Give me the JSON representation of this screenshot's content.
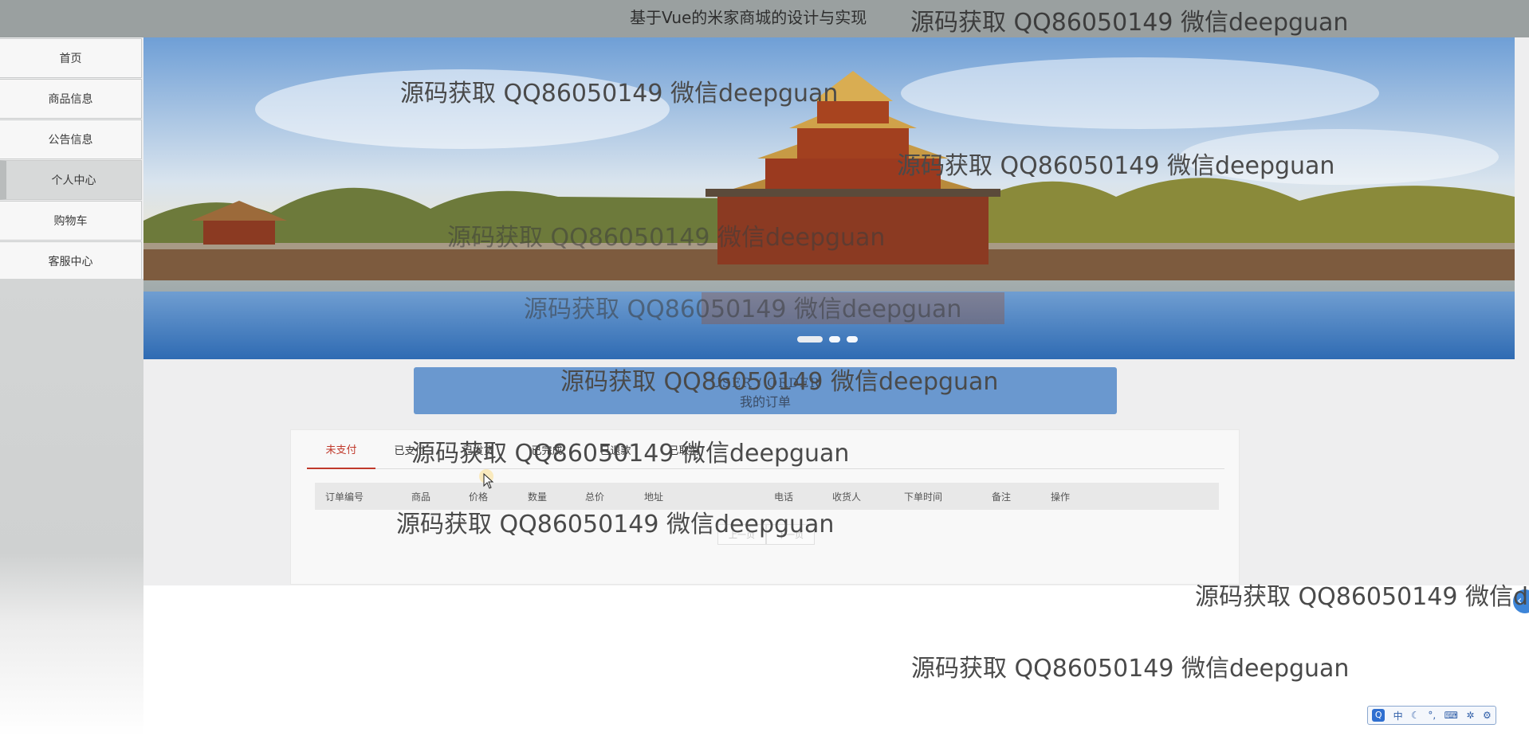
{
  "site": {
    "title": "基于Vue的米家商城的设计与实现"
  },
  "nav": {
    "items": [
      {
        "label": "首页",
        "active": false
      },
      {
        "label": "商品信息",
        "active": false
      },
      {
        "label": "公告信息",
        "active": false
      },
      {
        "label": "个人中心",
        "active": true
      },
      {
        "label": "购物车",
        "active": false
      },
      {
        "label": "客服中心",
        "active": false
      }
    ]
  },
  "banner": {
    "slides": 3,
    "active_slide": 1
  },
  "order_header": {
    "en": "USER / ORDER",
    "zh": "我的订单"
  },
  "tabs": [
    {
      "label": "未支付",
      "active": true
    },
    {
      "label": "已支付",
      "active": false
    },
    {
      "label": "已发货",
      "active": false
    },
    {
      "label": "已完成",
      "active": false
    },
    {
      "label": "已退款",
      "active": false
    },
    {
      "label": "已取消",
      "active": false
    }
  ],
  "table": {
    "columns": [
      "订单编号",
      "商品",
      "价格",
      "数量",
      "总价",
      "地址",
      "电话",
      "收货人",
      "下单时间",
      "备注",
      "操作"
    ],
    "rows": []
  },
  "pager": {
    "prev": "上一页",
    "next": "下一页"
  },
  "ime": {
    "logo": "Q",
    "lang": "中"
  },
  "watermark": {
    "text": "源码获取 QQ86050149 微信deepguan"
  },
  "colors": {
    "topbar": "#9aa0a0",
    "header_box": "#6a98cf",
    "active_tab": "#c0392b",
    "sidebar_active": "#d7d9d9"
  },
  "icons": {
    "side_button": "chevron-left-icon"
  }
}
